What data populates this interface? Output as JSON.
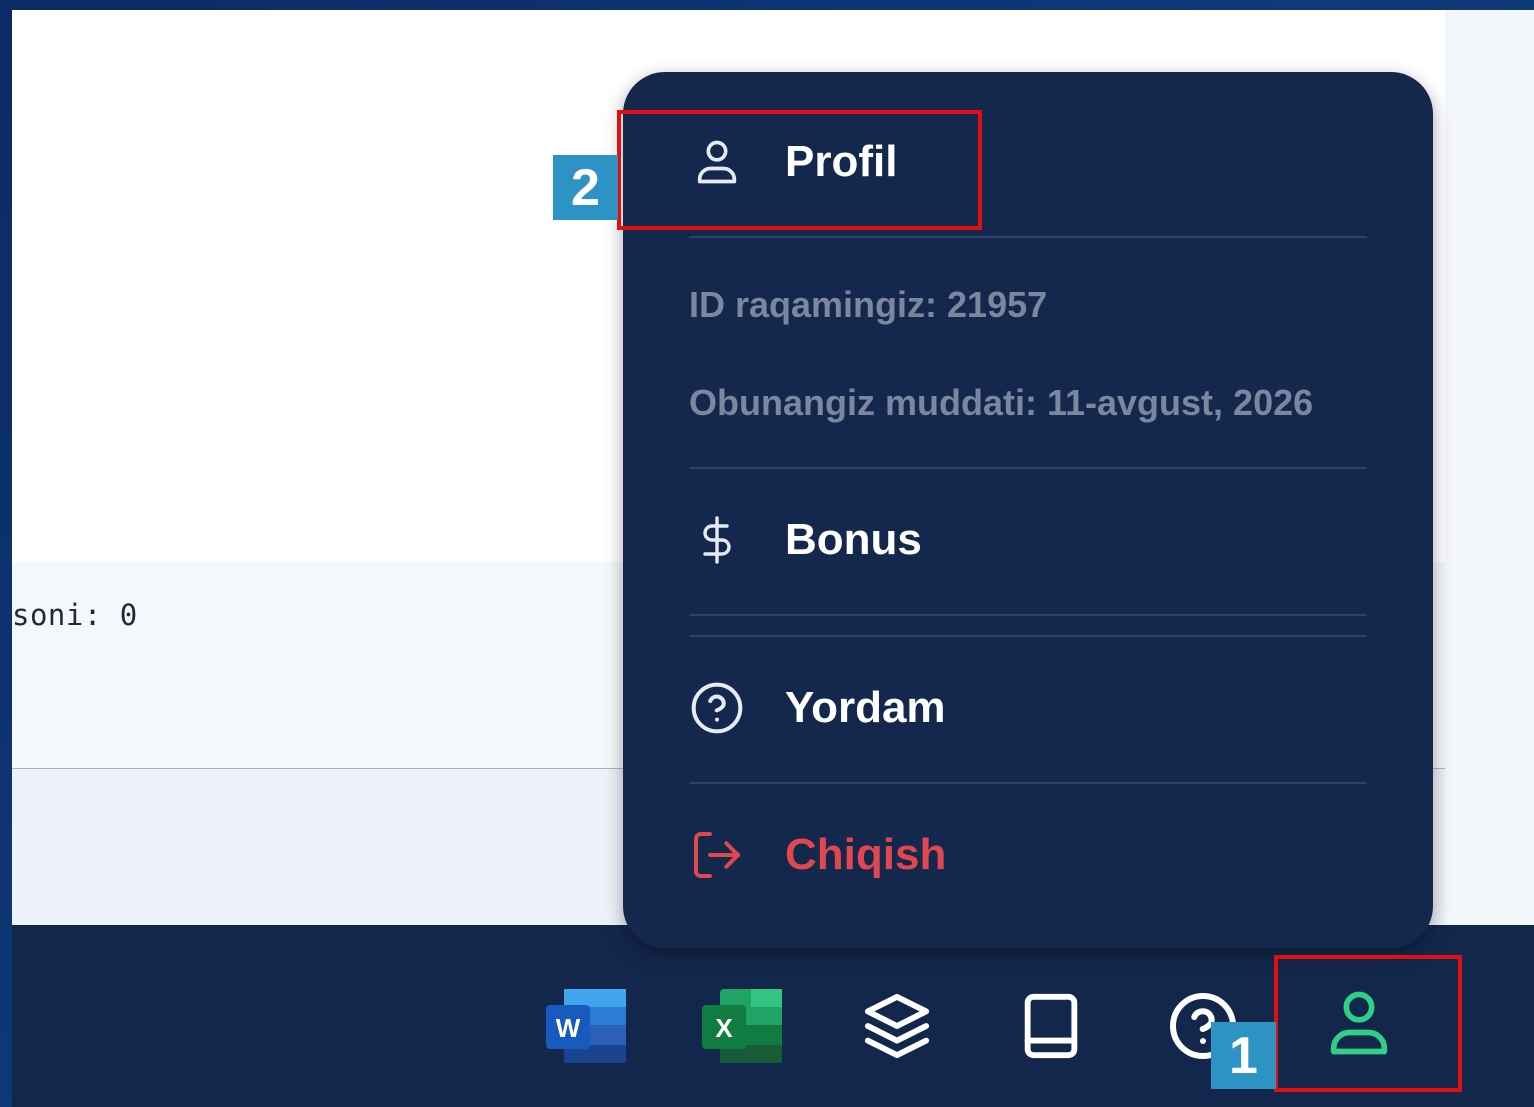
{
  "background_app": {
    "counter_text": "soni: 0"
  },
  "profile_menu": {
    "profile_label": "Profil",
    "id_text": "ID raqamingiz: 21957",
    "subscription_text": "Obunangiz muddati: 11-avgust, 2026",
    "bonus_label": "Bonus",
    "help_label": "Yordam",
    "logout_label": "Chiqish"
  },
  "taskbar": {
    "items": [
      "word-icon",
      "excel-icon",
      "layers-icon",
      "book-icon",
      "help-icon",
      "user-icon"
    ]
  },
  "annotations": {
    "badge_1": "1",
    "badge_2": "2"
  },
  "colors": {
    "menu_bg": "#14274d",
    "danger": "#e0474f",
    "accent_green": "#2fcf88",
    "annotation_red": "#e01010",
    "badge_blue": "#2c93c4"
  }
}
